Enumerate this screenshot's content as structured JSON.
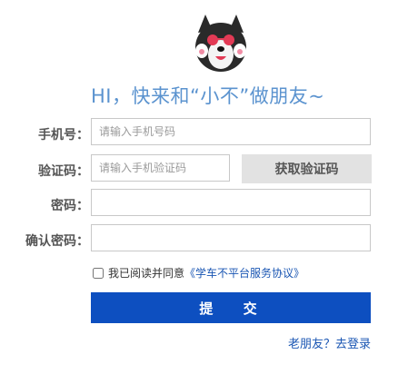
{
  "avatar": {
    "icon": "dog-avatar-icon"
  },
  "headline": "HI，快来和“小不”做朋友~",
  "form": {
    "phone": {
      "label": "手机号：",
      "placeholder": "请输入手机号码"
    },
    "code": {
      "label": "验证码：",
      "placeholder": "请输入手机验证码",
      "button": "获取验证码"
    },
    "password": {
      "label": "密码：",
      "placeholder": ""
    },
    "confirm": {
      "label": "确认密码：",
      "placeholder": ""
    },
    "agree": {
      "text": "我已阅读并同意",
      "link": "《学车不平台服务协议》",
      "checked": false
    },
    "submit": "提 交",
    "login_link": "老朋友？去登录"
  },
  "colors": {
    "accent": "#0d4fc0",
    "headline": "#5b93cf",
    "link": "#1a56b3"
  }
}
